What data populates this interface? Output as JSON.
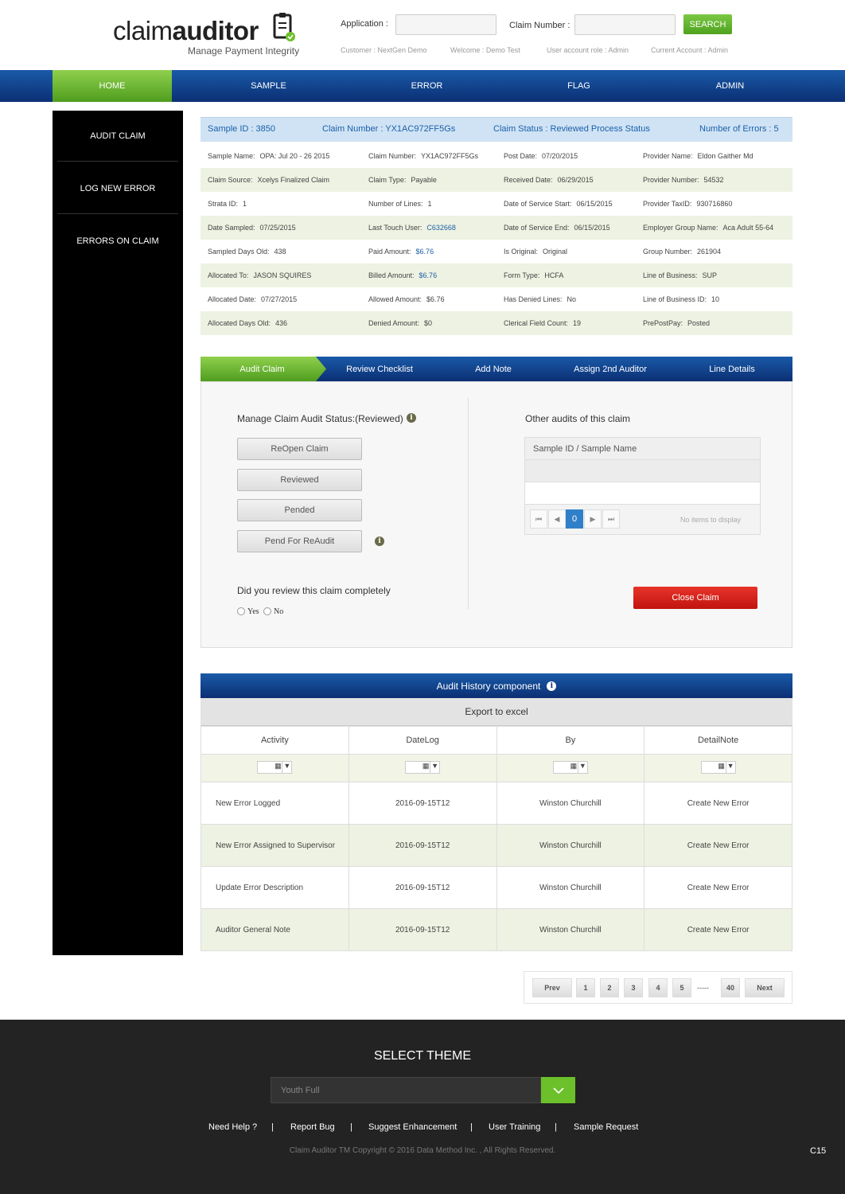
{
  "header": {
    "logo_light": "claim",
    "logo_bold": "auditor",
    "tagline": "Manage Payment Integrity",
    "application_label": "Application :",
    "application_value": "",
    "claim_number_label": "Claim Number :",
    "claim_number_value": "",
    "search_label": "SEARCH",
    "customer": "Customer : NextGen Demo",
    "welcome": "Welcome : Demo Test",
    "role": "User account role : Admin",
    "account": "Current Account : Admin"
  },
  "nav": [
    "HOME",
    "SAMPLE",
    "ERROR",
    "FLAG",
    "ADMIN"
  ],
  "sidebar": [
    "AUDIT CLAIM",
    "LOG NEW ERROR",
    "ERRORS ON CLAIM"
  ],
  "summary": {
    "sample_id": "Sample ID : 3850",
    "claim_number": "Claim Number : YX1AC972FF5Gs",
    "claim_status": "Claim Status : Reviewed Process Status",
    "errors": "Number of Errors : 5"
  },
  "details": [
    [
      [
        "Sample Name:",
        "OPA: Jul 20 - 26 2015"
      ],
      [
        "Claim Number:",
        "YX1AC972FF5Gs"
      ],
      [
        "Post Date:",
        "07/20/2015"
      ],
      [
        "Provider Name:",
        "Eldon Gaither Md"
      ]
    ],
    [
      [
        "Claim Source:",
        "Xcelys Finalized Claim"
      ],
      [
        "Claim Type:",
        "Payable"
      ],
      [
        "Received Date:",
        "06/29/2015"
      ],
      [
        "Provider Number:",
        "54532"
      ]
    ],
    [
      [
        "Strata ID:",
        "1"
      ],
      [
        "Number of Lines:",
        "1"
      ],
      [
        "Date of Service Start:",
        "06/15/2015"
      ],
      [
        "Provider TaxID:",
        "930716860"
      ]
    ],
    [
      [
        "Date Sampled:",
        "07/25/2015"
      ],
      [
        "Last Touch User:",
        "C632668"
      ],
      [
        "Date of Service End:",
        "06/15/2015"
      ],
      [
        "Employer Group Name:",
        "Aca Adult 55-64"
      ]
    ],
    [
      [
        "Sampled Days Old:",
        "438"
      ],
      [
        "Paid Amount:",
        "$6.76"
      ],
      [
        "Is Original:",
        "Original"
      ],
      [
        "Group Number:",
        "261904"
      ]
    ],
    [
      [
        "Allocated To:",
        "JASON SQUIRES"
      ],
      [
        "Billed Amount:",
        "$6.76"
      ],
      [
        "Form Type:",
        "HCFA"
      ],
      [
        "Line of Business:",
        "SUP"
      ]
    ],
    [
      [
        "Allocated Date:",
        "07/27/2015"
      ],
      [
        "Allowed Amount:",
        "$6.76"
      ],
      [
        "Has Denied Lines:",
        "No"
      ],
      [
        "Line of Business ID:",
        "10"
      ]
    ],
    [
      [
        "Allocated Days Old:",
        "436"
      ],
      [
        "Denied Amount:",
        "$0"
      ],
      [
        "Clerical Field Count:",
        "19"
      ],
      [
        "PrePostPay:",
        "Posted"
      ]
    ]
  ],
  "tabs": [
    "Audit Claim",
    "Review Checklist",
    "Add Note",
    "Assign 2nd Auditor",
    "Line Details"
  ],
  "audit_panel": {
    "status_title": "Manage Claim Audit Status:(Reviewed)",
    "buttons": [
      "ReOpen Claim",
      "Reviewed",
      "Pended",
      "Pend For ReAudit"
    ],
    "question": "Did you review this claim completely",
    "yes": "Yes",
    "no": "No",
    "other_title": "Other audits of this claim",
    "grid_header": "Sample ID / Sample Name",
    "current_page": "0",
    "no_items": "No items to display",
    "close_label": "Close Claim"
  },
  "history": {
    "title": "Audit History component",
    "export": "Export to excel",
    "columns": [
      "Activity",
      "DateLog",
      "By",
      "DetailNote"
    ],
    "rows": [
      [
        "New Error Logged",
        "2016-09-15T12",
        "Winston Churchill",
        "Create New Error"
      ],
      [
        "New Error Assigned to Supervisor",
        "2016-09-15T12",
        "Winston Churchill",
        "Create New Error"
      ],
      [
        "Update Error Description",
        "2016-09-15T12",
        "Winston Churchill",
        "Create New Error"
      ],
      [
        "Auditor General Note",
        "2016-09-15T12",
        "Winston Churchill",
        "Create New Error"
      ]
    ]
  },
  "pagination": {
    "prev": "Prev",
    "pages": [
      "1",
      "2",
      "3",
      "4",
      "5"
    ],
    "ellipsis": "-----",
    "last": "40",
    "next": "Next"
  },
  "footer": {
    "theme_title": "SELECT THEME",
    "theme_value": "Youth Full",
    "links": [
      "Need Help ?",
      "Report Bug",
      "Suggest Enhancement",
      "User Training",
      "Sample Request"
    ],
    "separator": "|",
    "copyright": "Claim Auditor TM Copyright © 2016 Data Method Inc. , All Rights Reserved.",
    "code": "C15"
  },
  "colors": {
    "brand_green": "#6cc02a",
    "nav_blue": "#0b2f73",
    "link_blue": "#1d5fa8",
    "close_red": "#d0201a"
  },
  "icons": [
    "clipboard-check-icon",
    "info-icon",
    "filter-icon",
    "calendar-icon",
    "first-page-icon",
    "prev-page-icon",
    "next-page-icon",
    "last-page-icon",
    "chevron-down-icon"
  ]
}
